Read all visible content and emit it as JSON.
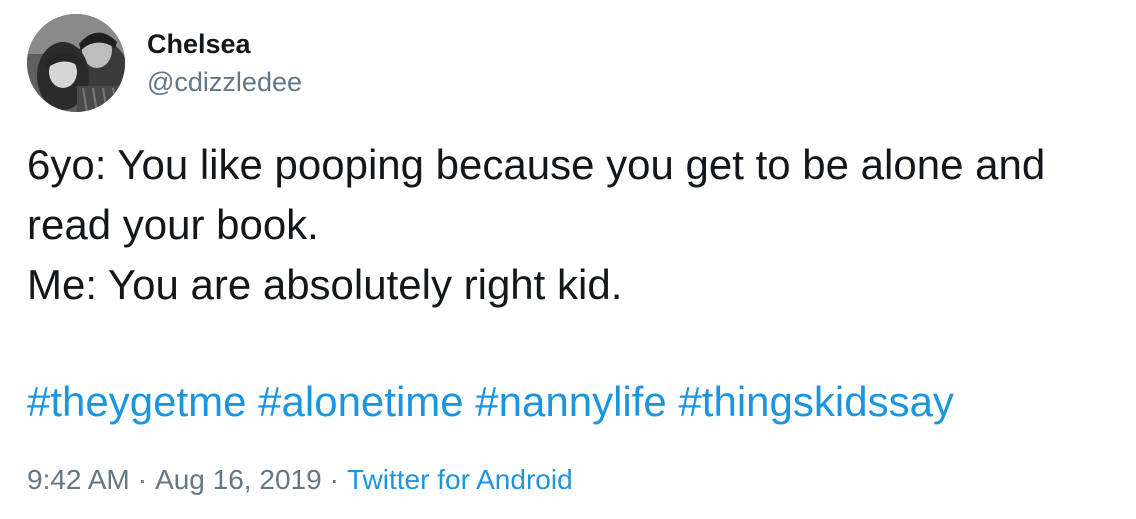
{
  "author": {
    "display_name": "Chelsea",
    "handle": "@cdizzledee",
    "avatar_icon": "profile-photo"
  },
  "tweet": {
    "lines": [
      "6yo: You like pooping because you get to be alone and",
      "read your book.",
      "Me: You are absolutely right kid."
    ],
    "hashtags": [
      "#theygetme",
      "#alonetime",
      "#nannylife",
      "#thingskidssay"
    ]
  },
  "meta": {
    "time": "9:42 AM",
    "separator": "·",
    "date": "Aug 16, 2019",
    "source": "Twitter for Android"
  },
  "colors": {
    "text": "#14171a",
    "secondary": "#657786",
    "link": "#1b95e0"
  }
}
